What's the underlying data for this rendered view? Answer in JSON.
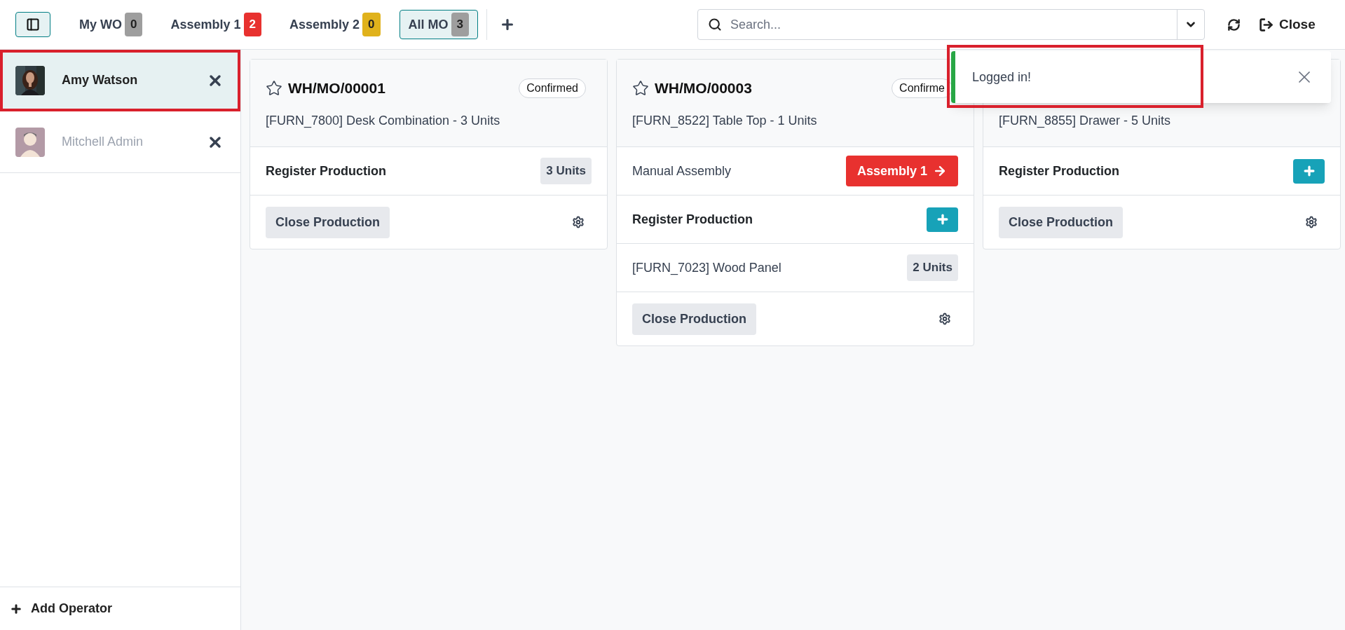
{
  "topbar": {
    "tabs": [
      {
        "label": "My WO",
        "count": "0",
        "color": "#9e9e9e",
        "selected": false
      },
      {
        "label": "Assembly 1",
        "count": "2",
        "color": "#e8312f",
        "selected": false
      },
      {
        "label": "Assembly 2",
        "count": "0",
        "color": "#e0b21c",
        "selected": false
      },
      {
        "label": "All MO",
        "count": "3",
        "color": "#9e9e9e",
        "selected": true
      }
    ],
    "search": {
      "placeholder": "Search..."
    },
    "close_label": "Close"
  },
  "operators": [
    {
      "name": "Amy Watson",
      "selected": true,
      "highlighted": true
    },
    {
      "name": "Mitchell Admin",
      "kind": "cartoon",
      "selected": false,
      "highlighted": false
    }
  ],
  "add_operator": "Add Operator",
  "cards": [
    {
      "title": "WH/MO/00001",
      "status": "Confirmed",
      "product": "[FURN_7800] Desk Combination - 3 Units",
      "rows": [
        {
          "kind": "register",
          "label": "Register Production",
          "quantity": "3 Units"
        }
      ],
      "footer_button": "Close Production"
    },
    {
      "title": "WH/MO/00003",
      "status": "Confirme",
      "product": "[FURN_8522] Table Top - 1 Units",
      "rows": [
        {
          "kind": "operation",
          "label": "Manual Assembly",
          "button": "Assembly 1"
        },
        {
          "kind": "register_add",
          "label": "Register Production"
        },
        {
          "kind": "component",
          "label": "[FURN_7023] Wood Panel",
          "quantity": "2 Units"
        }
      ],
      "footer_button": "Close Production"
    },
    {
      "product": "[FURN_8855] Drawer - 5 Units",
      "rows": [
        {
          "kind": "register_add",
          "label": "Register Production"
        }
      ],
      "footer_button": "Close Production"
    }
  ],
  "toast": {
    "message": "Logged in!",
    "highlighted": true
  }
}
